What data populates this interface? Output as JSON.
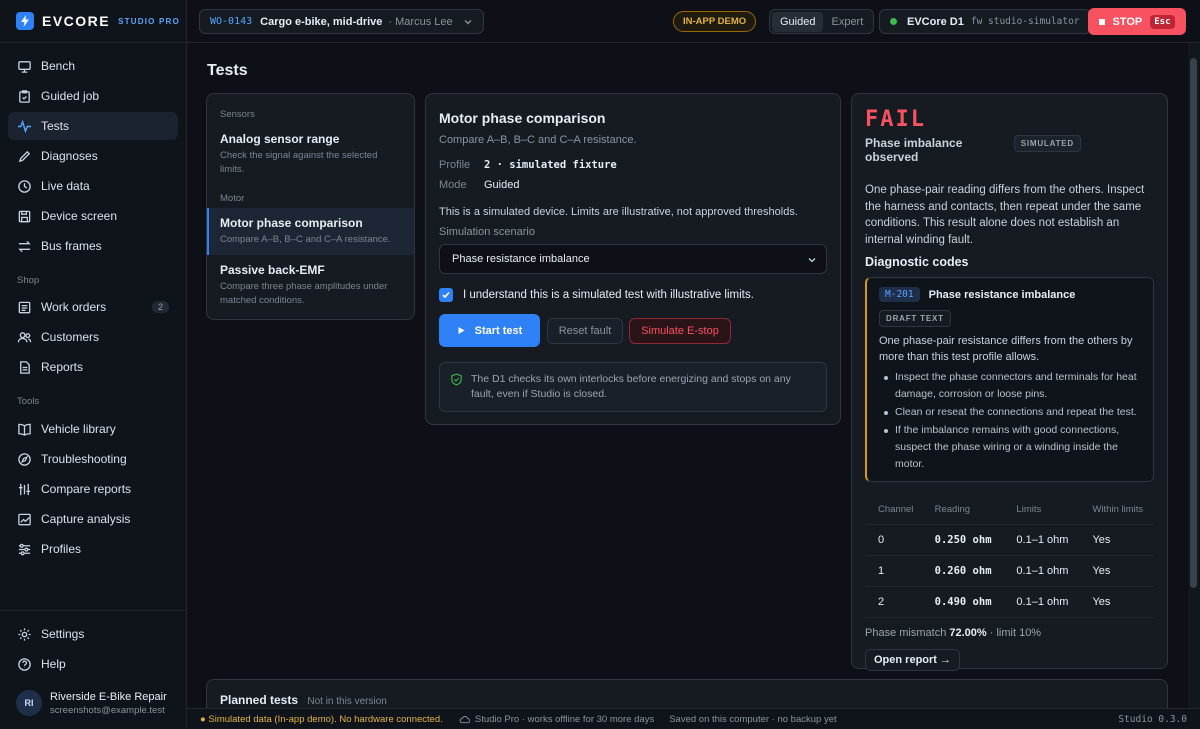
{
  "brand": {
    "name": "EVCORE",
    "sub": "STUDIO PRO"
  },
  "nav": {
    "items": [
      {
        "label": "Bench",
        "icon": "bench-icon"
      },
      {
        "label": "Guided job",
        "icon": "clipboard-icon"
      },
      {
        "label": "Tests",
        "icon": "pulse-icon"
      },
      {
        "label": "Diagnoses",
        "icon": "pencil-icon"
      },
      {
        "label": "Live data",
        "icon": "clock-icon"
      },
      {
        "label": "Device screen",
        "icon": "save-icon"
      },
      {
        "label": "Bus frames",
        "icon": "arrows-icon"
      }
    ],
    "shop_label": "Shop",
    "shop": [
      {
        "label": "Work orders",
        "icon": "list-icon",
        "badge": "2"
      },
      {
        "label": "Customers",
        "icon": "users-icon"
      },
      {
        "label": "Reports",
        "icon": "document-icon"
      }
    ],
    "tools_label": "Tools",
    "tools": [
      {
        "label": "Vehicle library",
        "icon": "book-icon"
      },
      {
        "label": "Troubleshooting",
        "icon": "compass-icon"
      },
      {
        "label": "Compare reports",
        "icon": "compare-icon"
      },
      {
        "label": "Capture analysis",
        "icon": "chart-icon"
      },
      {
        "label": "Profiles",
        "icon": "sliders-icon"
      }
    ],
    "settings": "Settings",
    "help": "Help"
  },
  "account": {
    "initials": "RI",
    "name": "Riverside E-Bike Repair",
    "email": "screenshots@example.test"
  },
  "topbar": {
    "wo_id": "WO-0143",
    "wo_title": "Cargo e-bike, mid-drive",
    "wo_customer": "· Marcus Lee",
    "demo_badge": "IN-APP DEMO",
    "mode_guided": "Guided",
    "mode_expert": "Expert",
    "device_name": "EVCore D1",
    "device_fw": "fw studio-simulator",
    "stop_label": "STOP",
    "stop_key": "Esc"
  },
  "page": {
    "title": "Tests"
  },
  "tests_list": {
    "sensors_label": "Sensors",
    "motor_label": "Motor",
    "items": [
      {
        "name": "Analog sensor range",
        "desc": "Check the signal against the selected limits."
      },
      {
        "name": "Motor phase comparison",
        "desc": "Compare A–B, B–C and C–A resistance."
      },
      {
        "name": "Passive back-EMF",
        "desc": "Compare three phase amplitudes under matched conditions."
      }
    ]
  },
  "test_detail": {
    "title": "Motor phase comparison",
    "subtitle": "Compare A–B, B–C and C–A resistance.",
    "profile_label": "Profile",
    "profile_value": "2 · simulated fixture",
    "mode_label": "Mode",
    "mode_value": "Guided",
    "sim_note": "This is a simulated device. Limits are illustrative, not approved thresholds.",
    "scenario_label": "Simulation scenario",
    "scenario_value": "Phase resistance imbalance",
    "ack_label": "I understand this is a simulated test with illustrative limits.",
    "start_label": "Start test",
    "reset_label": "Reset fault",
    "estop_label": "Simulate E-stop",
    "safety_note": "The D1 checks its own interlocks before energizing and stops on any fault, even if Studio is closed."
  },
  "result": {
    "status": "FAIL",
    "headline": "Phase imbalance observed",
    "sim_badge": "SIMULATED",
    "body": "One phase-pair reading differs from the others. Inspect the harness and contacts, then repeat under the same conditions. This result alone does not establish an internal winding fault.",
    "codes_title": "Diagnostic codes",
    "code": {
      "id": "M-201",
      "title": "Phase resistance imbalance",
      "draft": "DRAFT TEXT",
      "desc": "One phase-pair resistance differs from the others by more than this test profile allows.",
      "steps": [
        "Inspect the phase connectors and terminals for heat damage, corrosion or loose pins.",
        "Clean or reseat the connections and repeat the test.",
        "If the imbalance remains with good connections, suspect the phase wiring or a winding inside the motor."
      ]
    },
    "table": {
      "headers": [
        "Channel",
        "Reading",
        "Limits",
        "Within limits"
      ],
      "rows": [
        [
          "0",
          "0.250 ohm",
          "0.1–1 ohm",
          "Yes"
        ],
        [
          "1",
          "0.260 ohm",
          "0.1–1 ohm",
          "Yes"
        ],
        [
          "2",
          "0.490 ohm",
          "0.1–1 ohm",
          "Yes"
        ]
      ]
    },
    "mismatch_prefix": "Phase mismatch ",
    "mismatch_value": "72.00%",
    "mismatch_suffix": " · limit 10%",
    "open_report": "Open report →"
  },
  "planned": {
    "title": "Planned tests",
    "note": "Not in this version"
  },
  "status": {
    "sim": "Simulated data (In-app demo). No hardware connected.",
    "cloud": "Studio Pro · works offline for 30 more days",
    "saved": "Saved on this computer · no backup yet",
    "version": "Studio 0.3.0"
  },
  "colors": {
    "accent": "#2f81f7",
    "fail": "#f85160",
    "warn": "#e3b341",
    "ok": "#3fb950"
  }
}
